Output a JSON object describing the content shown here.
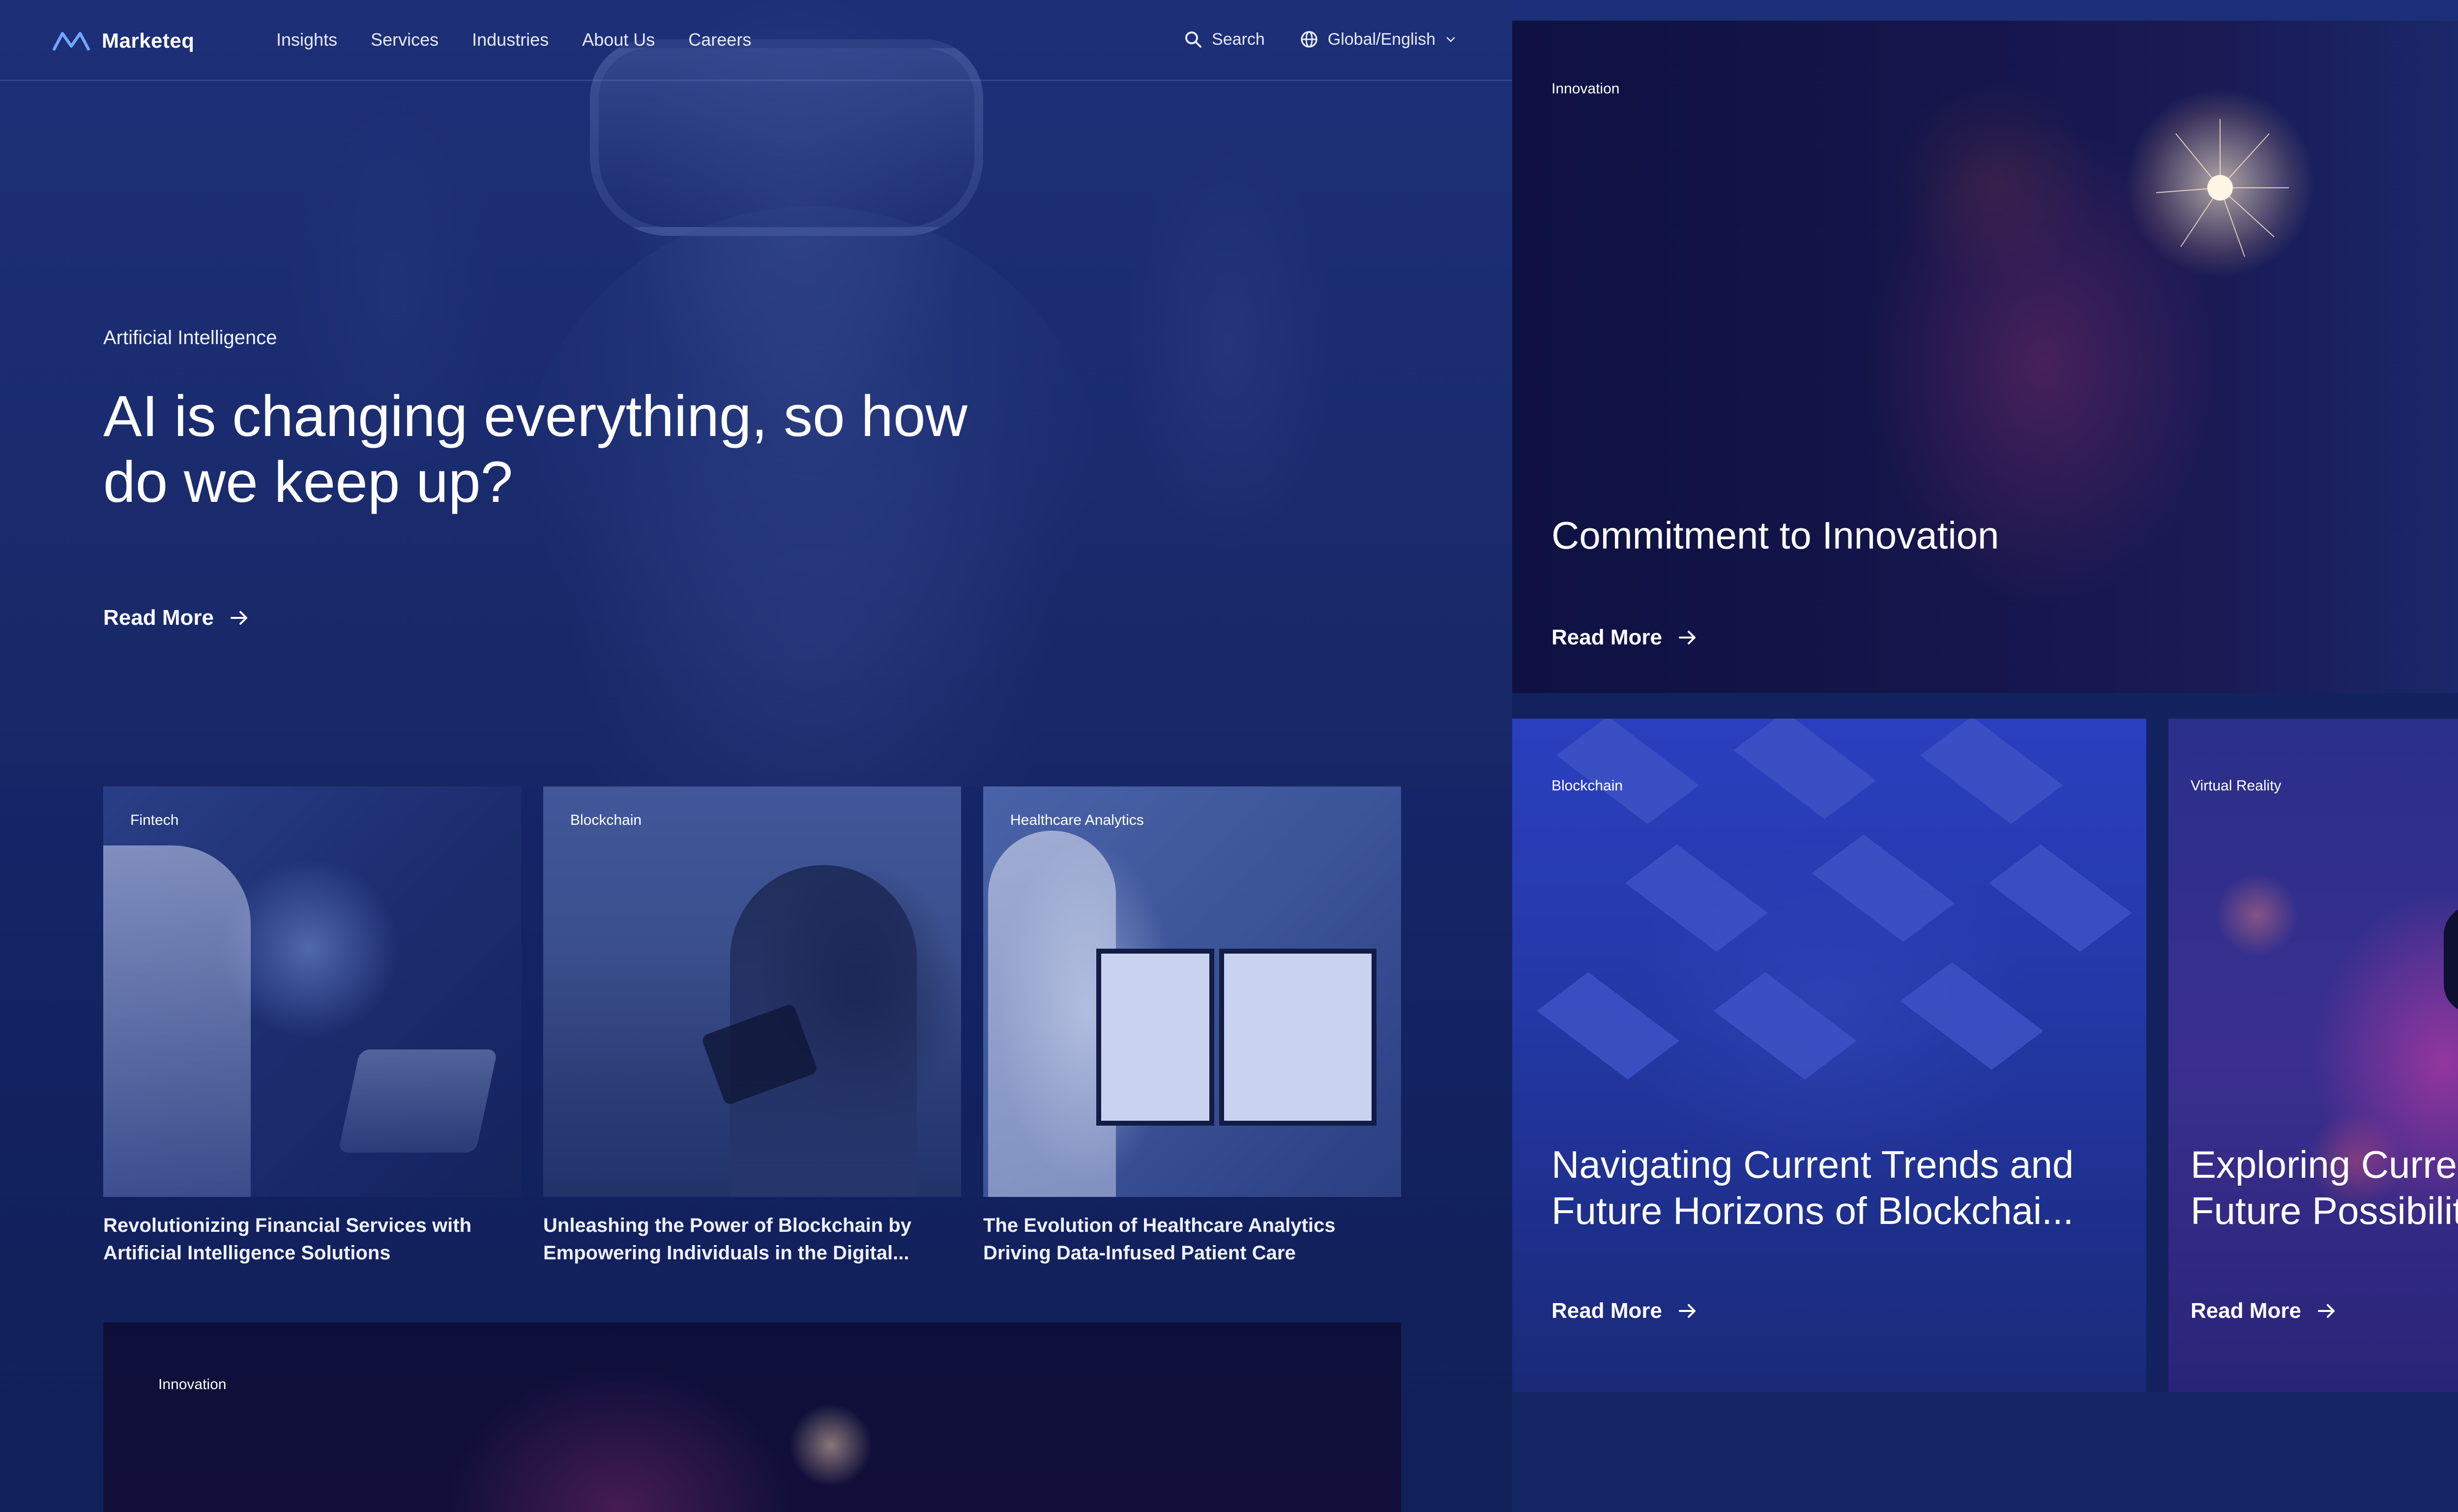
{
  "brand": {
    "name": "Marketeq"
  },
  "nav": {
    "links": [
      "Insights",
      "Services",
      "Industries",
      "About Us",
      "Careers"
    ],
    "search_label": "Search",
    "locale_label": "Global/English"
  },
  "hero": {
    "category": "Artificial Intelligence",
    "title": "AI is changing everything, so how do we keep up?",
    "read_more": "Read More"
  },
  "cards": [
    {
      "tag": "Fintech",
      "title": "Revolutionizing Financial Services with Artificial Intelligence Solutions"
    },
    {
      "tag": "Blockchain",
      "title": "Unleashing the Power of Blockchain by Empowering Individuals in the Digital..."
    },
    {
      "tag": "Healthcare Analytics",
      "title": "The Evolution of Healthcare Analytics Driving Data-Infused Patient Care"
    }
  ],
  "banner": {
    "tag": "Innovation"
  },
  "gallery": {
    "innovation": {
      "tag": "Innovation",
      "title": "Commitment to Innovation",
      "read_more": "Read More"
    },
    "blockchain": {
      "tag": "Blockchain",
      "title_line1": "Navigating Current Trends and",
      "title_line2": "Future Horizons of Blockchai...",
      "read_more": "Read More"
    },
    "vr": {
      "tag": "Virtual Reality",
      "title_line1": "Exploring Curren",
      "title_line2": "Future Possibiliti",
      "read_more": "Read More"
    }
  },
  "icons": {
    "logo": "marketeq-logo-icon",
    "search": "search-icon",
    "globe": "globe-icon",
    "chevron": "chevron-down-icon",
    "arrow": "arrow-right-icon"
  },
  "colors": {
    "background": "#1a2b6e",
    "text": "#ffffff",
    "accent_pink": "#dc3caa",
    "blockchain_blue": "#2a3fbf"
  }
}
